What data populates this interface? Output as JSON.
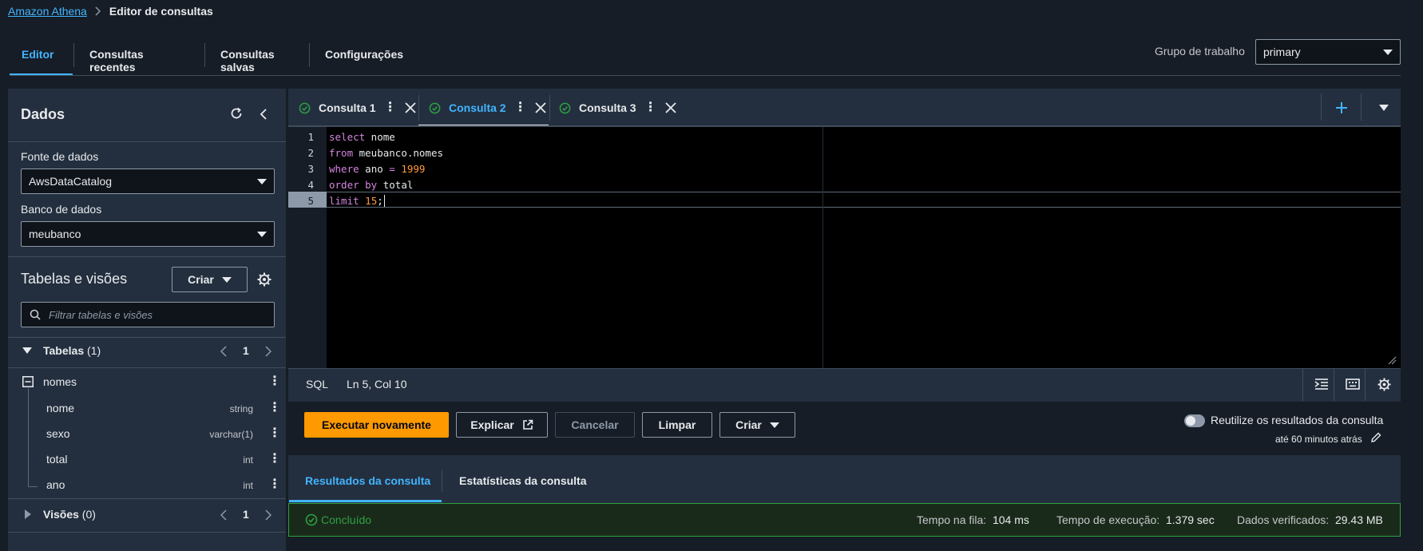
{
  "breadcrumb": {
    "root": "Amazon Athena",
    "current": "Editor de consultas"
  },
  "top_tabs": [
    "Editor",
    "Consultas recentes",
    "Consultas salvas",
    "Configurações"
  ],
  "workgroup": {
    "label": "Grupo de trabalho",
    "value": "primary"
  },
  "data_panel": {
    "title": "Dados",
    "source_label": "Fonte de dados",
    "source_value": "AwsDataCatalog",
    "database_label": "Banco de dados",
    "database_value": "meubanco",
    "tables_views_title": "Tabelas e visões",
    "create_label": "Criar",
    "filter_placeholder": "Filtrar tabelas e visões",
    "tables": {
      "label": "Tabelas",
      "count": "(1)",
      "page": "1"
    },
    "table_name": "nomes",
    "columns": [
      {
        "name": "nome",
        "type": "string"
      },
      {
        "name": "sexo",
        "type": "varchar(1)"
      },
      {
        "name": "total",
        "type": "int"
      },
      {
        "name": "ano",
        "type": "int"
      }
    ],
    "views": {
      "label": "Visões",
      "count": "(0)",
      "page": "1"
    }
  },
  "query_tabs": [
    "Consulta 1",
    "Consulta 2",
    "Consulta 3"
  ],
  "active_query_tab": "Consulta 2",
  "editor": {
    "line_numbers": [
      "1",
      "2",
      "3",
      "4",
      "5"
    ],
    "lines": [
      [
        {
          "t": "select",
          "c": "kw"
        },
        {
          "t": " nome",
          "c": "id"
        }
      ],
      [
        {
          "t": "from",
          "c": "kw"
        },
        {
          "t": " meubanco.nomes",
          "c": "id"
        }
      ],
      [
        {
          "t": "where",
          "c": "kw"
        },
        {
          "t": " ano ",
          "c": "id"
        },
        {
          "t": "=",
          "c": "op"
        },
        {
          "t": " ",
          "c": "id"
        },
        {
          "t": "1999",
          "c": "num"
        }
      ],
      [
        {
          "t": "order by",
          "c": "kw"
        },
        {
          "t": " total",
          "c": "id"
        }
      ],
      [
        {
          "t": "limit",
          "c": "kw"
        },
        {
          "t": " ",
          "c": "id"
        },
        {
          "t": "15",
          "c": "num"
        },
        {
          "t": ";",
          "c": "id"
        }
      ]
    ]
  },
  "status": {
    "language": "SQL",
    "cursor": "Ln 5, Col 10"
  },
  "actions": {
    "run_again": "Executar novamente",
    "explain": "Explicar",
    "cancel": "Cancelar",
    "clear": "Limpar",
    "create": "Criar",
    "reuse_label": "Reutilize os resultados da consulta",
    "reuse_sub": "até 60 minutos atrás"
  },
  "result_tabs": [
    "Resultados da consulta",
    "Estatísticas da consulta"
  ],
  "result": {
    "status": "Concluído",
    "queue_label": "Tempo na fila:",
    "queue_value": "104 ms",
    "exec_label": "Tempo de execução:",
    "exec_value": "1.379 sec",
    "scanned_label": "Dados verificados:",
    "scanned_value": "29.43 MB"
  },
  "colors": {
    "accent": "#42b4ff",
    "primary_button": "#ff9900",
    "success": "#2ea043"
  }
}
